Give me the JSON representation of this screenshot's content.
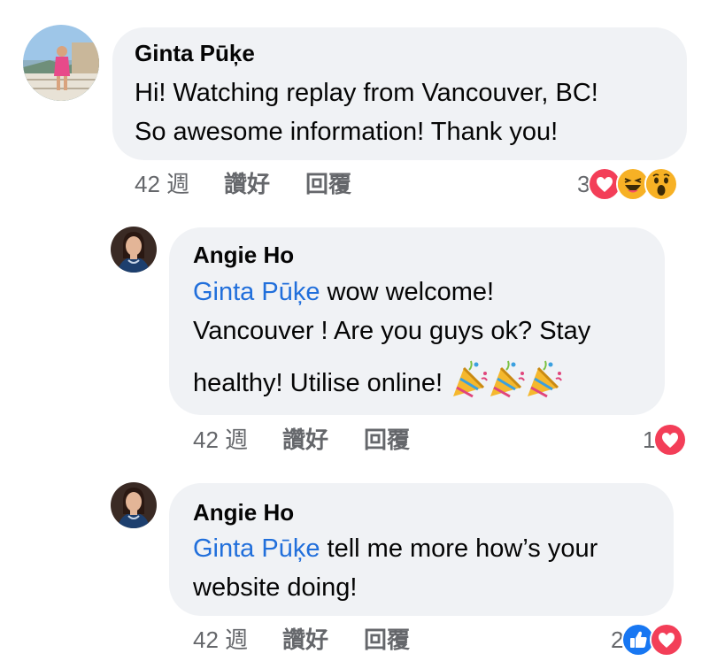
{
  "comments": [
    {
      "author": "Ginta Pūķe",
      "line1": "Hi! Watching replay from Vancouver, BC!",
      "line2": "So awesome information! Thank you!",
      "time": "42 週",
      "like_label": "讚好",
      "reply_label": "回覆",
      "reaction_count": "3",
      "reactions": [
        "love",
        "haha",
        "wow"
      ]
    },
    {
      "author": "Angie Ho",
      "mention": "Ginta Pūķe",
      "line1_rest": " wow welcome!",
      "line2": "Vancouver ! Are you guys ok? Stay",
      "line3": "healthy! Utilise online! ",
      "emoji": [
        "party-popper",
        "party-popper",
        "party-popper"
      ],
      "time": "42 週",
      "like_label": "讚好",
      "reply_label": "回覆",
      "reaction_count": "1",
      "reactions": [
        "love"
      ]
    },
    {
      "author": "Angie Ho",
      "mention": "Ginta Pūķe",
      "line1_rest": " tell me more how’s your",
      "line2": "website doing!",
      "time": "42 週",
      "like_label": "讚好",
      "reply_label": "回覆",
      "reaction_count": "2",
      "reactions": [
        "like",
        "love"
      ]
    }
  ],
  "colors": {
    "bubble": "#f0f2f5",
    "mention": "#216fdb",
    "meta": "#65676b",
    "love": "#f33e58",
    "like": "#1877f2",
    "haha": "#f7b125"
  }
}
